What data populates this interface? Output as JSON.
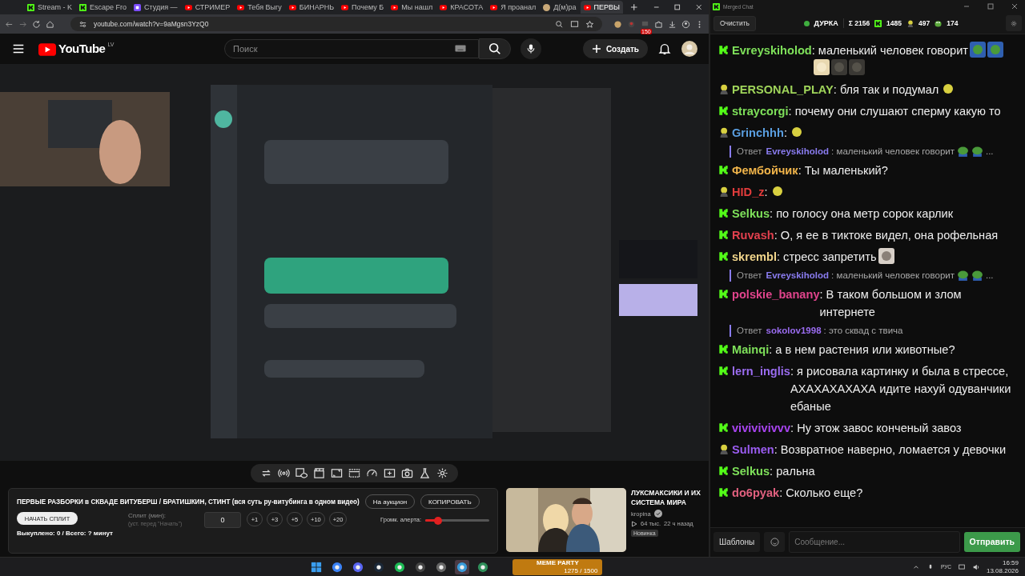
{
  "browser": {
    "tabs": [
      {
        "label": "Stream - K",
        "kind": "kick",
        "selected": false
      },
      {
        "label": "Escape Fro",
        "kind": "kick",
        "selected": false
      },
      {
        "label": "Студия —",
        "kind": "studio",
        "selected": false
      },
      {
        "label": "СТРИМЕР",
        "kind": "video",
        "selected": false
      },
      {
        "label": "Тебя Выгу",
        "kind": "video",
        "selected": false
      },
      {
        "label": "БИНАРНЬ",
        "kind": "video",
        "selected": false
      },
      {
        "label": "Почему Б",
        "kind": "video",
        "selected": false
      },
      {
        "label": "Мы нашл",
        "kind": "video",
        "selected": false
      },
      {
        "label": "КРАСОТА",
        "kind": "video",
        "selected": false
      },
      {
        "label": "Я проанал",
        "kind": "video",
        "selected": false
      },
      {
        "label": "Д(м)ра",
        "kind": "other",
        "selected": false
      },
      {
        "label": "ПЕРВЫ",
        "kind": "video",
        "selected": true
      }
    ],
    "url": "youtube.com/watch?v=9aMgsn3YzQ0",
    "badge": "150"
  },
  "youtube": {
    "logo": "YouTube",
    "region": "LV",
    "search": {
      "placeholder": "Поиск"
    },
    "create": "Создать"
  },
  "panel": {
    "title": "ПЕРВЫЕ РАЗБОРКИ в СКВАДЕ ВИТУБЕРШ / БРАТИШКИН, СТИНТ (вся суть ру-витубинга в одном видео)",
    "buttons": [
      "На аукцион",
      "КОПИРОВАТЬ"
    ],
    "start_split": "НАЧАТЬ СПЛИТ",
    "split_label": "Сплит (мин):",
    "split_hint": "(уст. перед \"Начать\")",
    "split_value": "0",
    "increments": [
      "+1",
      "+3",
      "+5",
      "+10",
      "+20"
    ],
    "bought": "Выкуплено: 0 / Всего: ? минут",
    "alert_label": "Громк. алерта:",
    "alert_level": {
      "level": 0.2
    }
  },
  "recommendation": {
    "kind": "picture",
    "title": "ЛУКСМАКСИКИ И ИХ СИСТЕМА МИРА",
    "channel": "kropina",
    "views": "64 тыс.",
    "age": "22 ч назад",
    "badge": "Новинка"
  },
  "chat": {
    "title": "Merged Chat",
    "clear": "Очистить",
    "channel": "ДУРКА",
    "live": true,
    "stats": [
      {
        "kind": "sum",
        "value": "Σ 2156"
      },
      {
        "kind": "kick",
        "value": "1485"
      },
      {
        "kind": "head",
        "value": "497"
      },
      {
        "kind": "frog",
        "value": "174"
      }
    ],
    "messages": [
      {
        "kind": "message",
        "badge": {
          "kind": "kick"
        },
        "user": "Evreyskiholod",
        "color": "#7ee05a",
        "text": ": маленький человек говорит",
        "emotes": [
          {
            "kind": "frog"
          },
          {
            "kind": "frog"
          },
          {
            "kind": "face"
          },
          {
            "kind": "seal"
          },
          {
            "kind": "seal"
          }
        ]
      },
      {
        "kind": "message",
        "badge": {
          "kind": "head"
        },
        "user": "PERSONAL_PLAY",
        "color": "#9fd45a",
        "text": ": бля так и подумал",
        "emotes": [
          {
            "kind": "head"
          }
        ]
      },
      {
        "kind": "message",
        "badge": {
          "kind": "kick"
        },
        "user": "straycorgi",
        "color": "#7ee05a",
        "text": ": почему они слушают сперму какую то"
      },
      {
        "kind": "message",
        "badge": {
          "kind": "head"
        },
        "user": "Grinchhh",
        "color": "#5a9ee0",
        "text": ":",
        "emotes": [
          {
            "kind": "head"
          }
        ]
      },
      {
        "kind": "reply",
        "prefix": "Ответ",
        "user": "Evreyskiholod",
        "color": "#8a7cf0",
        "text": ": маленький человек говорит",
        "emotes": [
          {
            "kind": "frog"
          },
          {
            "kind": "frog"
          }
        ],
        "tail": "..."
      },
      {
        "kind": "message",
        "badge": {
          "kind": "kick"
        },
        "user": "Фембойчик",
        "color": "#f0b44a",
        "text": ": Ты маленький?"
      },
      {
        "kind": "message",
        "badge": {
          "kind": "head"
        },
        "user": "HID_z",
        "color": "#e23c3c",
        "text": ":",
        "emotes": [
          {
            "kind": "head"
          }
        ]
      },
      {
        "kind": "message",
        "badge": {
          "kind": "kick"
        },
        "user": "Selkus",
        "color": "#7ee05a",
        "text": ": по голосу она метр сорок карлик"
      },
      {
        "kind": "message",
        "badge": {
          "kind": "kick"
        },
        "user": "Ruvash",
        "color": "#e2404e",
        "text": ": О, я ее в тиктоке видел, она рофельная"
      },
      {
        "kind": "message",
        "badge": {
          "kind": "kick"
        },
        "user": "skrembl",
        "color": "#f0d48a",
        "text": ": стресс запретить",
        "emotes": [
          {
            "kind": "cat"
          }
        ]
      },
      {
        "kind": "reply",
        "prefix": "Ответ",
        "user": "Evreyskiholod",
        "color": "#8a7cf0",
        "text": ": маленький человек говорит",
        "emotes": [
          {
            "kind": "frog"
          },
          {
            "kind": "frog"
          }
        ],
        "tail": "..."
      },
      {
        "kind": "message",
        "badge": {
          "kind": "kick"
        },
        "user": "polskie_banany",
        "color": "#e0448c",
        "text": ": В таком большом и злом интернете"
      },
      {
        "kind": "reply",
        "prefix": "Ответ",
        "user": "sokolov1998",
        "color": "#9a6cf0",
        "text": ": это сквад с твича"
      },
      {
        "kind": "message",
        "badge": {
          "kind": "kick"
        },
        "user": "Mainqi",
        "color": "#7ee05a",
        "text": ": а в нем растения или животные?"
      },
      {
        "kind": "message",
        "badge": {
          "kind": "kick"
        },
        "user": "lern_inglis",
        "color": "#9a6cf0",
        "text": ": я рисовала картинку и была в стрессе, АХАХАХАХАХА идите нахуй одуванчики ебаные"
      },
      {
        "kind": "message",
        "badge": {
          "kind": "kick"
        },
        "user": "vivivivivvv",
        "color": "#a844f0",
        "text": ": Ну этож завос конченый завоз"
      },
      {
        "kind": "message",
        "badge": {
          "kind": "head"
        },
        "user": "Sulmen",
        "color": "#9a5cf0",
        "text": ": Возвратное наверно, ломается у девочки"
      },
      {
        "kind": "message",
        "badge": {
          "kind": "kick"
        },
        "user": "Selkus",
        "color": "#7ee05a",
        "text": ": ральна"
      },
      {
        "kind": "message",
        "badge": {
          "kind": "kick"
        },
        "user": "do6pyak",
        "color": "#e0607e",
        "text": ": Сколько еще?"
      }
    ],
    "templates": "Шаблоны",
    "input": {
      "placeholder": "Сообщение..."
    },
    "send": "Отправить"
  },
  "taskbar": {
    "widget_title": "MEME PARTY",
    "widget_value": "1275 / 1500",
    "language": "РУС",
    "time": "16:59",
    "date": "13.08.2026"
  }
}
